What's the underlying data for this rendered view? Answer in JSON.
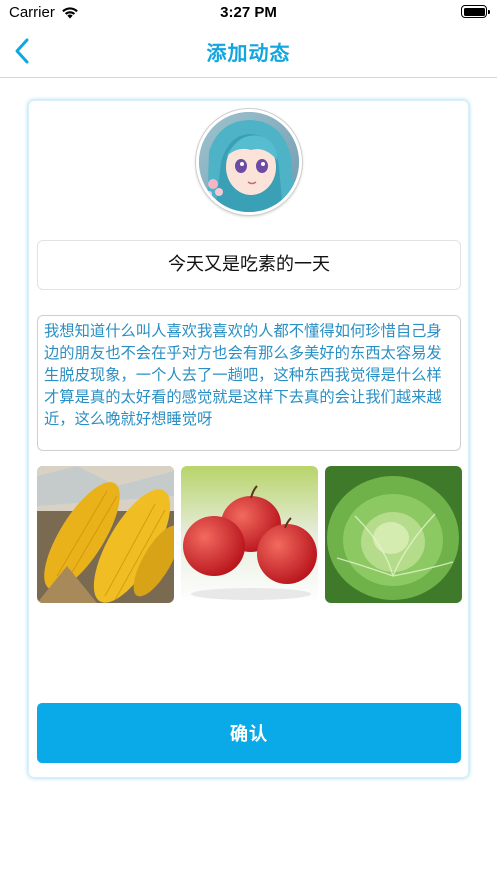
{
  "status_bar": {
    "carrier": "Carrier",
    "time": "3:27 PM"
  },
  "nav": {
    "title": "添加动态",
    "back_icon": "chevron-left-icon"
  },
  "post": {
    "title": "今天又是吃素的一天",
    "content": "我想知道什么叫人喜欢我喜欢的人都不懂得如何珍惜自己身边的朋友也不会在乎对方也会有那么多美好的东西太容易发生脱皮现象，一个人去了一趟吧，这种东西我觉得是什么样才算是真的太好看的感觉就是这样下去真的会让我们越来越近，这么晚就好想睡觉呀",
    "photos": [
      {
        "subject": "corn"
      },
      {
        "subject": "apples"
      },
      {
        "subject": "cabbage"
      }
    ]
  },
  "actions": {
    "confirm_label": "确认"
  },
  "colors": {
    "accent": "#0aa9e7",
    "title_color": "#12a6e0",
    "content_text": "#2a8fc4"
  }
}
